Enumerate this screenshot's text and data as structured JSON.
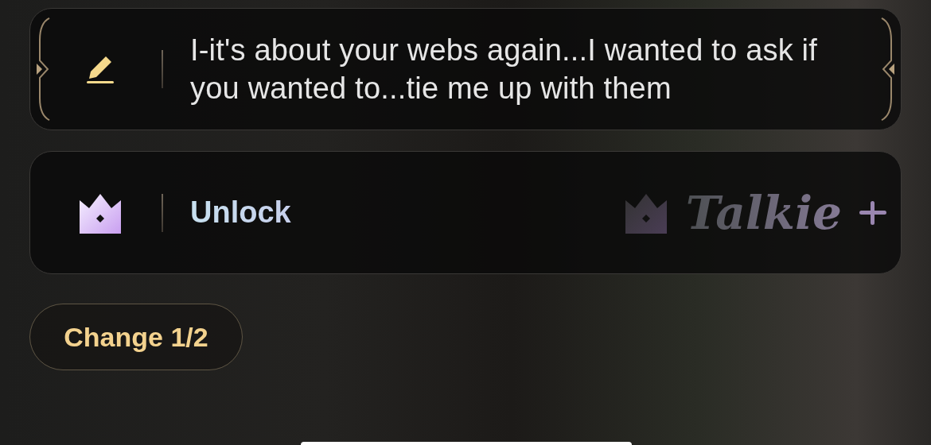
{
  "reply_card": {
    "text": "I-it's about your webs again...I wanted to ask if you wanted to...tie me up with them"
  },
  "unlock_card": {
    "label": "Unlock",
    "brand": "Talkie"
  },
  "change_button": {
    "label": "Change 1/2"
  }
}
